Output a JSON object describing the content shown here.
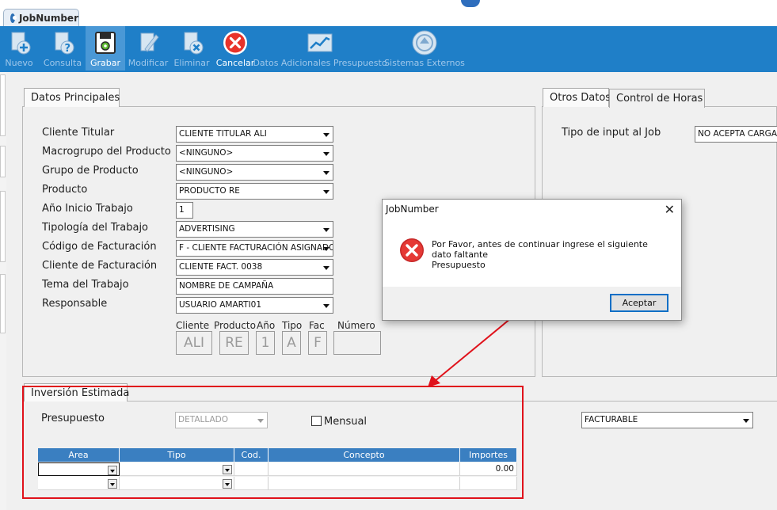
{
  "window": {
    "tab_title": "JobNumber"
  },
  "toolbar": {
    "buttons": [
      {
        "label": "Nuevo",
        "icon": "new-document-icon",
        "enabled": false
      },
      {
        "label": "Consulta",
        "icon": "query-document-icon",
        "enabled": false
      },
      {
        "label": "Grabar",
        "icon": "save-disk-icon",
        "enabled": true,
        "selected": true
      },
      {
        "label": "Modificar",
        "icon": "edit-document-icon",
        "enabled": false
      },
      {
        "label": "Eliminar",
        "icon": "delete-document-icon",
        "enabled": false
      },
      {
        "label": "Cancelar",
        "icon": "cancel-circle-icon",
        "enabled": true
      },
      {
        "label": "Datos Adicionales Presupuesto",
        "icon": "chart-line-icon",
        "enabled": false
      },
      {
        "label": "Sistemas Externos",
        "icon": "external-systems-icon",
        "enabled": false
      }
    ]
  },
  "principal": {
    "tab_label": "Datos Principales",
    "fields": [
      {
        "label": "Cliente Titular",
        "value": "CLIENTE TITULAR ALI",
        "kind": "combo"
      },
      {
        "label": "Macrogrupo del Producto",
        "value": "<NINGUNO>",
        "kind": "combo"
      },
      {
        "label": "Grupo de Producto",
        "value": "<NINGUNO>",
        "kind": "combo"
      },
      {
        "label": "Producto",
        "value": "PRODUCTO RE",
        "kind": "combo"
      },
      {
        "label": "Año Inicio Trabajo",
        "value": "1",
        "kind": "text"
      },
      {
        "label": "Tipología del Trabajo",
        "value": "ADVERTISING",
        "kind": "combo"
      },
      {
        "label": "Código de Facturación",
        "value": "F - CLIENTE FACTURACIÓN ASIGNADO",
        "kind": "combo"
      },
      {
        "label": "Cliente de Facturación",
        "value": "CLIENTE FACT. 0038",
        "kind": "combo"
      },
      {
        "label": "Tema del Trabajo",
        "value": "NOMBRE DE CAMPAÑA",
        "kind": "text"
      },
      {
        "label": "Responsable",
        "value": "USUARIO AMARTI01",
        "kind": "combo"
      }
    ],
    "code_parts": [
      {
        "label": "Cliente",
        "value": "ALI"
      },
      {
        "label": "Producto",
        "value": "RE"
      },
      {
        "label": "Año",
        "value": "1"
      },
      {
        "label": "Tipo",
        "value": "A"
      },
      {
        "label": "Fac",
        "value": "F"
      },
      {
        "label": "Número",
        "value": ""
      }
    ]
  },
  "otros": {
    "tab_label": "Otros Datos",
    "tab2_label": "Control de Horas",
    "input_label": "Tipo de input al Job",
    "input_value": "NO ACEPTA CARGA D"
  },
  "inversion": {
    "tab_label": "Inversión Estimada",
    "presupuesto_label": "Presupuesto",
    "presupuesto_value": "DETALLADO",
    "mensual_label": "Mensual",
    "mensual_checked": false,
    "facturable_value": "FACTURABLE",
    "columns": [
      "Area",
      "Tipo",
      "Cod.",
      "Concepto",
      "Importes"
    ],
    "rows": [
      {
        "importe": "0.00"
      },
      {
        "importe": ""
      }
    ]
  },
  "dialog": {
    "title": "JobNumber",
    "message_line1": "Por Favor, antes de continuar ingrese el siguiente dato faltante",
    "message_line2": "Presupuesto",
    "button_label": "Aceptar",
    "icon": "error-icon"
  },
  "colors": {
    "toolbar": "#1f7fc8",
    "grid_header": "#3a7fc1",
    "annotation": "#e0121b"
  }
}
